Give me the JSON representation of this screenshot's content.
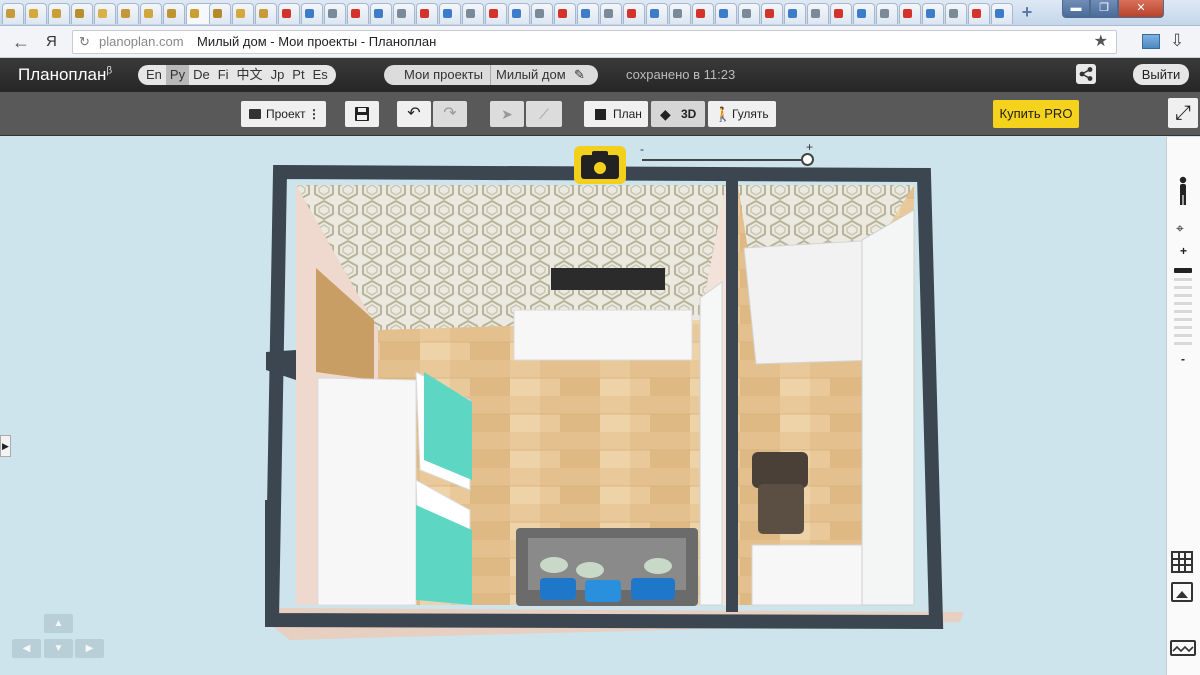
{
  "browser": {
    "url_host": "planoplan.com",
    "tab_title": "Милый дом - Мои проекты - Планоплан",
    "ya_label": "Я"
  },
  "app": {
    "logo": "Планоплан",
    "logo_beta": "β",
    "languages": [
      "En",
      "Ру",
      "De",
      "Fi",
      "中文",
      "Jp",
      "Pt",
      "Es"
    ],
    "selected_language": "Ру",
    "breadcrumb": {
      "projects": "Мои проекты",
      "current": "Милый дом"
    },
    "saved_status": "сохранено в 11:23",
    "logout_label": "Выйти"
  },
  "toolbar": {
    "project_label": "Проект",
    "plan_label": "План",
    "view3d_label": "3D",
    "walk_label": "Гулять",
    "buy_pro_label": "Купить PRO",
    "active_view": "3D"
  },
  "viewport": {
    "zoom_minus": "-",
    "zoom_plus": "+",
    "zoom_level": 1.0
  },
  "rail": {
    "zoom_plus": "+",
    "zoom_minus": "-",
    "zoom_level": 1.0
  },
  "colors": {
    "accent": "#f5d21c",
    "wall": "#3b4650",
    "floor": "#e8c796",
    "bedding": "#5ed6c4",
    "pillows": "#1f77c9"
  }
}
